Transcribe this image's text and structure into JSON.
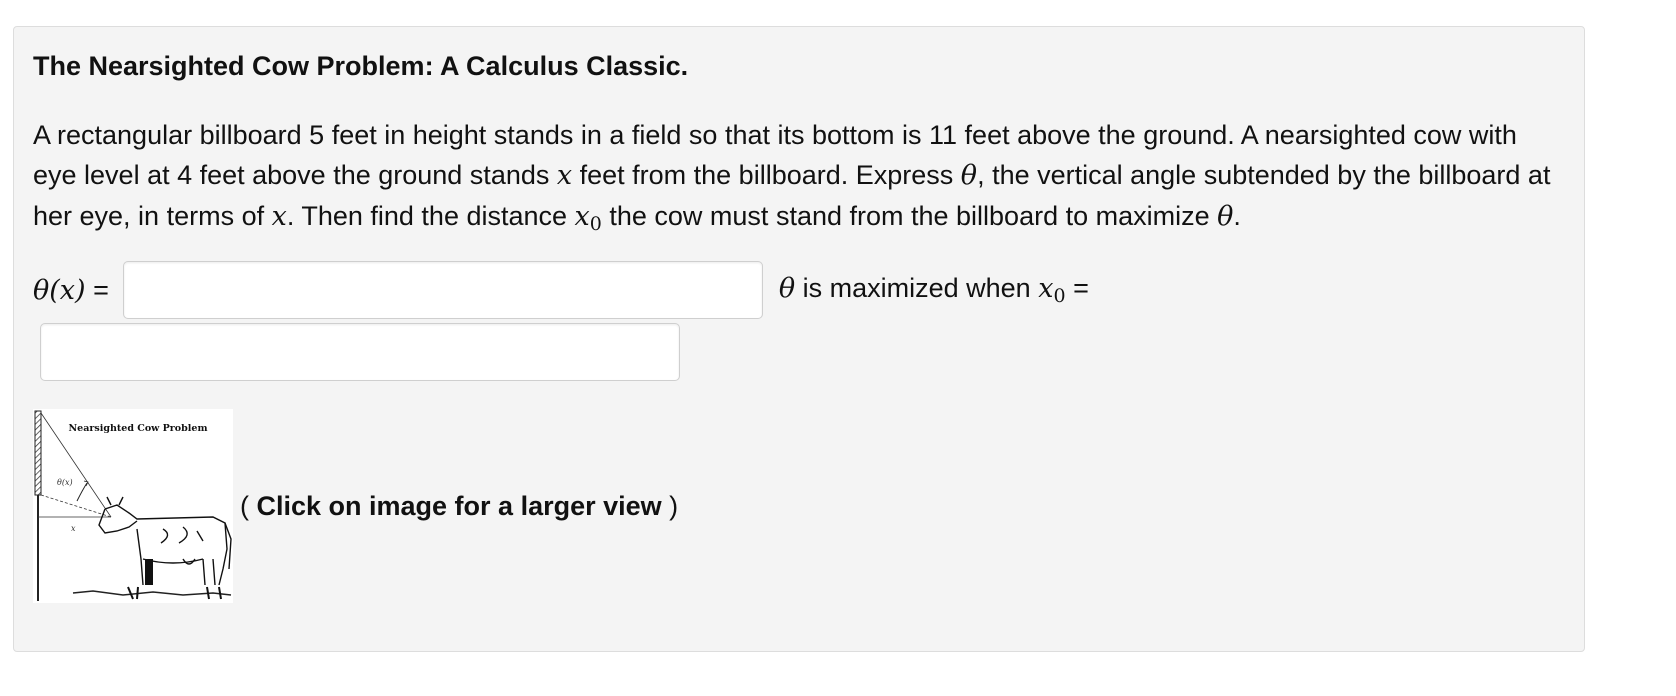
{
  "title": "The Nearsighted Cow Problem: A Calculus Classic.",
  "problem": {
    "t1": "A rectangular billboard 5 feet in height stands in a field so that its bottom is 11 feet above the ground. A nearsighted cow with eye level at 4 feet above the ground stands ",
    "var_x": "x",
    "t2": " feet from the billboard. Express ",
    "var_theta": "θ",
    "t3": ", the vertical angle subtended by the billboard at her eye, in terms of ",
    "t4": ". Then find the distance ",
    "var_x0_base": "x",
    "var_x0_sub": "0",
    "t5": " the cow must stand from the billboard to maximize ",
    "t6": "."
  },
  "answers": {
    "theta_label_fn": "θ(x)",
    "equals": "=",
    "theta_value": "",
    "max_label_theta": "θ",
    "max_label_text": " is maximized when ",
    "max_label_x": "x",
    "max_label_sub": "0",
    "x0_value": ""
  },
  "figure": {
    "caption": "Nearsighted Cow Problem",
    "angle_label": "θ(x)",
    "x_label": "x",
    "icon": "nearsighted-cow-diagram"
  },
  "click_note": {
    "open": "( ",
    "bold": "Click on image for a larger view",
    "close": " )"
  }
}
